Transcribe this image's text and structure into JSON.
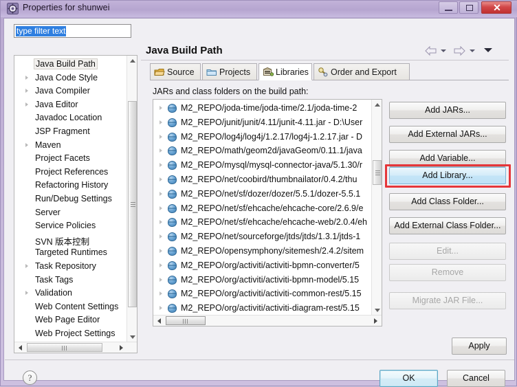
{
  "window": {
    "title": "Properties for shunwei",
    "icon": "eclipse-properties-icon",
    "buttons": {
      "minimize": "minimize-icon",
      "maximize": "maximize-icon",
      "close": "✕"
    }
  },
  "filter": {
    "value": "type filter text",
    "placeholder": "type filter text"
  },
  "tree": {
    "items": [
      {
        "label": "Java Build Path",
        "expandable": false,
        "selected": true
      },
      {
        "label": "Java Code Style",
        "expandable": true,
        "selected": false
      },
      {
        "label": "Java Compiler",
        "expandable": true,
        "selected": false
      },
      {
        "label": "Java Editor",
        "expandable": true,
        "selected": false
      },
      {
        "label": "Javadoc Location",
        "expandable": false,
        "selected": false
      },
      {
        "label": "JSP Fragment",
        "expandable": false,
        "selected": false
      },
      {
        "label": "Maven",
        "expandable": true,
        "selected": false
      },
      {
        "label": "Project Facets",
        "expandable": false,
        "selected": false
      },
      {
        "label": "Project References",
        "expandable": false,
        "selected": false
      },
      {
        "label": "Refactoring History",
        "expandable": false,
        "selected": false
      },
      {
        "label": "Run/Debug Settings",
        "expandable": false,
        "selected": false
      },
      {
        "label": "Server",
        "expandable": false,
        "selected": false
      },
      {
        "label": "Service Policies",
        "expandable": false,
        "selected": false
      },
      {
        "label": "SVN 版本控制",
        "expandable": false,
        "selected": false
      },
      {
        "label": "Targeted Runtimes",
        "expandable": false,
        "selected": false
      },
      {
        "label": "Task Repository",
        "expandable": true,
        "selected": false
      },
      {
        "label": "Task Tags",
        "expandable": false,
        "selected": false
      },
      {
        "label": "Validation",
        "expandable": true,
        "selected": false
      },
      {
        "label": "Web Content Settings",
        "expandable": false,
        "selected": false
      },
      {
        "label": "Web Page Editor",
        "expandable": false,
        "selected": false
      },
      {
        "label": "Web Project Settings",
        "expandable": false,
        "selected": false
      }
    ]
  },
  "page": {
    "title": "Java Build Path",
    "nav": {
      "back": "back-arrow-icon",
      "back_menu": "chevron-down-icon",
      "forward": "forward-arrow-icon",
      "forward_menu": "chevron-down-icon",
      "view_menu": "view-menu-icon"
    }
  },
  "tabs": [
    {
      "label": "Source",
      "icon": "source-folder-icon",
      "active": false
    },
    {
      "label": "Projects",
      "icon": "projects-icon",
      "active": false
    },
    {
      "label": "Libraries",
      "icon": "libraries-icon",
      "active": true
    },
    {
      "label": "Order and Export",
      "icon": "order-export-icon",
      "active": false
    }
  ],
  "list": {
    "caption": "JARs and class folders on the build path:",
    "rows": [
      "M2_REPO/joda-time/joda-time/2.1/joda-time-2",
      "M2_REPO/junit/junit/4.11/junit-4.11.jar - D:\\User",
      "M2_REPO/log4j/log4j/1.2.17/log4j-1.2.17.jar - D",
      "M2_REPO/math/geom2d/javaGeom/0.11.1/java",
      "M2_REPO/mysql/mysql-connector-java/5.1.30/r",
      "M2_REPO/net/coobird/thumbnailator/0.4.2/thu",
      "M2_REPO/net/sf/dozer/dozer/5.5.1/dozer-5.5.1",
      "M2_REPO/net/sf/ehcache/ehcache-core/2.6.9/e",
      "M2_REPO/net/sf/ehcache/ehcache-web/2.0.4/eh",
      "M2_REPO/net/sourceforge/jtds/jtds/1.3.1/jtds-1",
      "M2_REPO/opensymphony/sitemesh/2.4.2/sitem",
      "M2_REPO/org/activiti/activiti-bpmn-converter/5",
      "M2_REPO/org/activiti/activiti-bpmn-model/5.15",
      "M2_REPO/org/activiti/activiti-common-rest/5.15",
      "M2_REPO/org/activiti/activiti-diagram-rest/5.15"
    ]
  },
  "side_buttons": [
    {
      "label": "Add JARs...",
      "state": "normal"
    },
    {
      "label": "Add External JARs...",
      "state": "normal"
    },
    {
      "label": "Add Variable...",
      "state": "normal"
    },
    {
      "label": "Add Library...",
      "state": "highlighted"
    },
    {
      "label": "Add Class Folder...",
      "state": "normal"
    },
    {
      "label": "Add External Class Folder...",
      "state": "normal"
    },
    {
      "label": "Edit...",
      "state": "disabled"
    },
    {
      "label": "Remove",
      "state": "disabled"
    },
    {
      "label": "Migrate JAR File...",
      "state": "disabled"
    }
  ],
  "footer": {
    "apply": "Apply",
    "ok": "OK",
    "cancel": "Cancel",
    "help": "?"
  },
  "annotation": {
    "color": "#e5363a",
    "target": "Add Library..."
  }
}
